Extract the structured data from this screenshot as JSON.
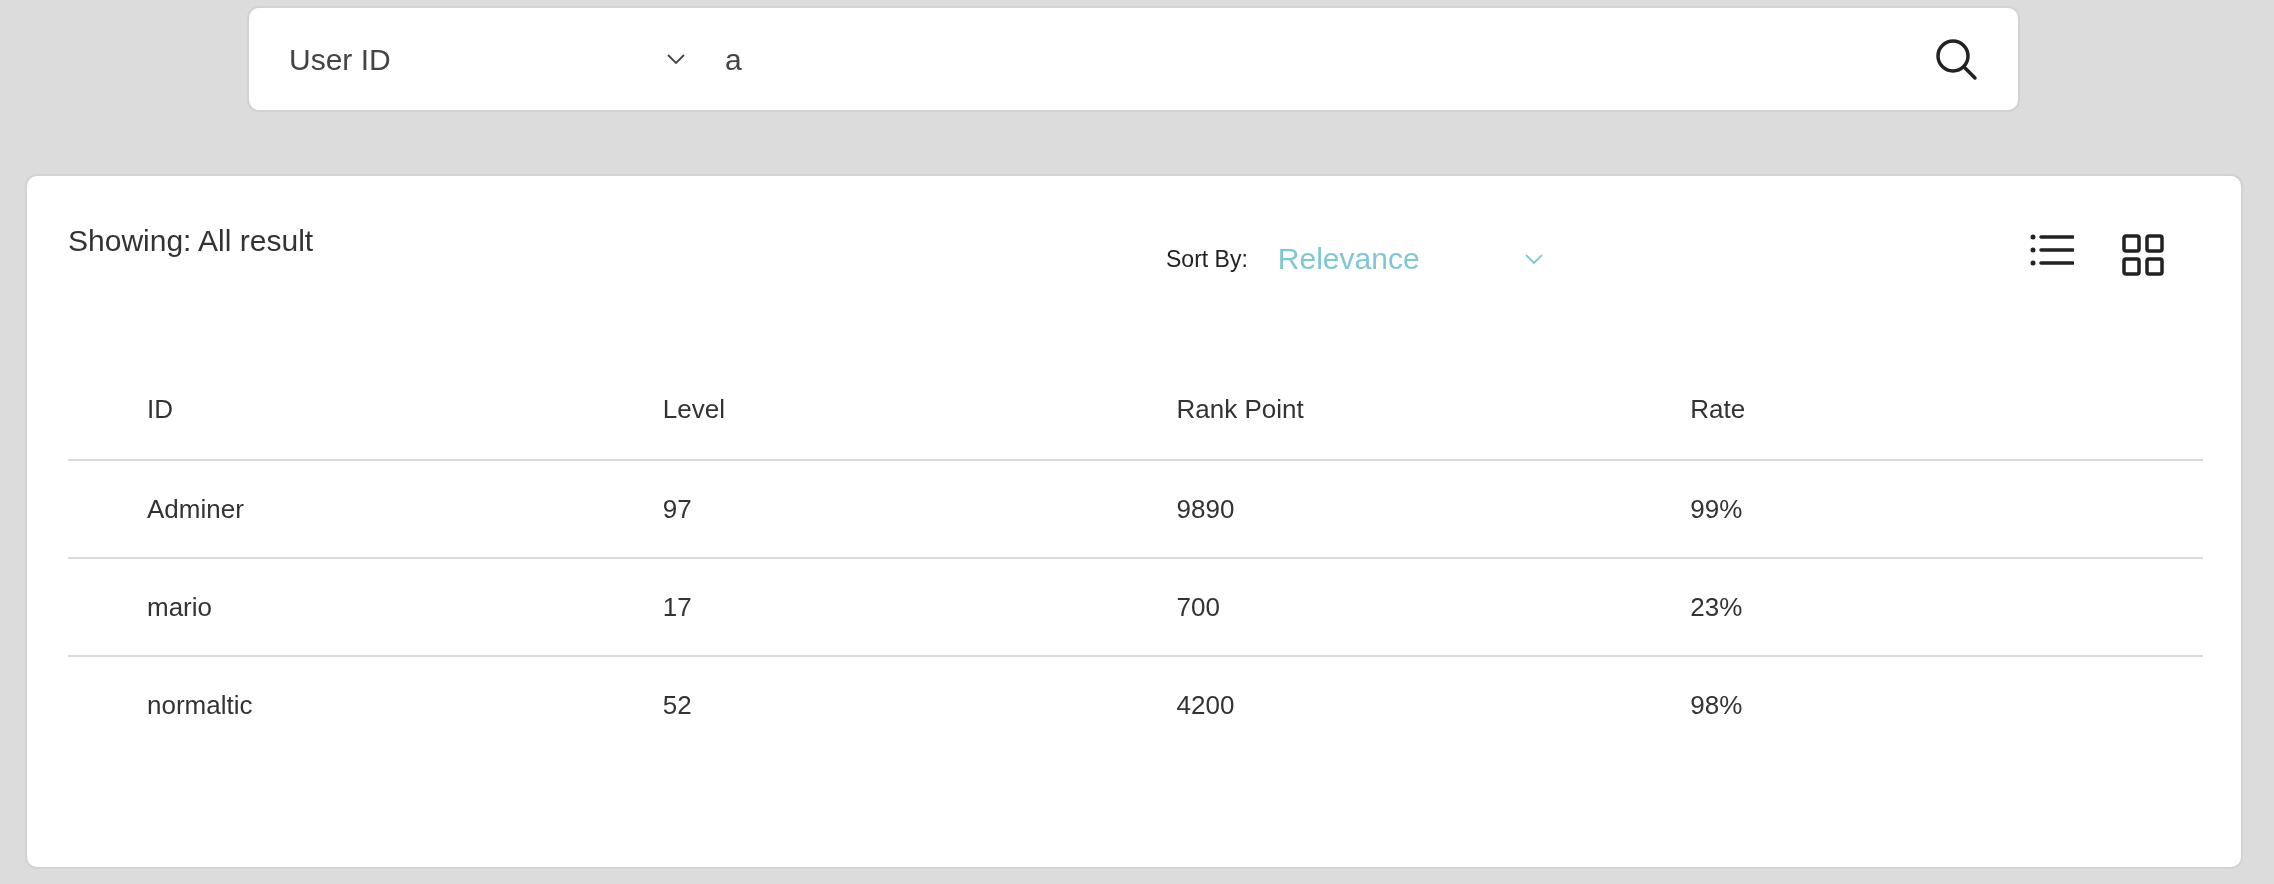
{
  "search": {
    "field": "User ID",
    "query": "a"
  },
  "results": {
    "showing": "Showing: All result",
    "sort_label": "Sort By:",
    "sort_value": "Relevance"
  },
  "table": {
    "columns": [
      "ID",
      "Level",
      "Rank Point",
      "Rate"
    ],
    "rows": [
      [
        "Adminer",
        "97",
        "9890",
        "99%"
      ],
      [
        "mario",
        "17",
        "700",
        "23%"
      ],
      [
        "normaltic",
        "52",
        "4200",
        "98%"
      ]
    ]
  }
}
